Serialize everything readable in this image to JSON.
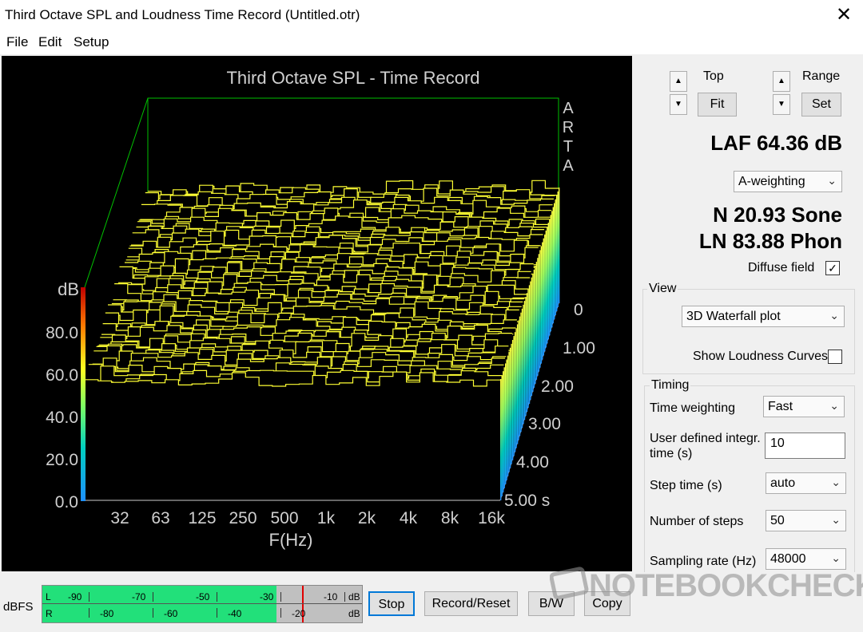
{
  "window": {
    "title": "Third Octave SPL and Loudness Time Record (Untitled.otr)",
    "close_glyph": "✕"
  },
  "menu": [
    "File",
    "Edit",
    "Setup"
  ],
  "plot": {
    "title": "Third Octave SPL - Time Record",
    "brand_letters": [
      "A",
      "R",
      "T",
      "A"
    ],
    "y_unit": "dB",
    "y_ticks": [
      "80.0",
      "60.0",
      "40.0",
      "20.0",
      "0.0"
    ],
    "x_ticks": [
      "32",
      "63",
      "125",
      "250",
      "500",
      "1k",
      "2k",
      "4k",
      "8k",
      "16k"
    ],
    "x_label": "F(Hz)",
    "t_ticks": [
      "0",
      "1.00",
      "2.00",
      "3.00",
      "4.00",
      "5.00 s"
    ],
    "trace_color": "#ffff33",
    "axis_color": "#00c000"
  },
  "chart_data": {
    "type": "area",
    "title": "Third Octave SPL - Time Record",
    "xlabel": "F(Hz)",
    "ylabel": "dB",
    "zlabel": "",
    "x_scale": "log",
    "x_ticks": [
      "32",
      "63",
      "125",
      "250",
      "500",
      "1k",
      "2k",
      "4k",
      "8k",
      "16k"
    ],
    "ylim": [
      0,
      100
    ],
    "time_range_s": [
      0,
      5
    ],
    "steps": 50,
    "approx_level_db": 60
  },
  "controls": {
    "top_label": "Top",
    "fit_label": "Fit",
    "range_label": "Range",
    "set_label": "Set",
    "spin_up": "▲",
    "spin_down": "▼",
    "laf": "LAF 64.36 dB",
    "weighting": "A-weighting",
    "loudness_n": "N 20.93 Sone",
    "loudness_ln": "LN 83.88 Phon",
    "diffuse_label": "Diffuse field",
    "diffuse_checked": "✓"
  },
  "view": {
    "group_label": "View",
    "mode": "3D Waterfall plot",
    "show_curves_label": "Show Loudness Curves"
  },
  "timing": {
    "group_label": "Timing",
    "time_weighting_label": "Time weighting",
    "time_weighting": "Fast",
    "user_integr_label_1": "User defined integr.",
    "user_integr_label_2": "time (s)",
    "user_integr_value": "10",
    "step_time_label": "Step time (s)",
    "step_time": "auto",
    "num_steps_label": "Number of steps",
    "num_steps": "50",
    "sampling_label": "Sampling rate (Hz)",
    "sampling": "48000"
  },
  "bottom": {
    "dbfs_label": "dBFS",
    "meter_L": "L",
    "meter_R": "R",
    "scale_top": [
      "-90",
      "-70",
      "-50",
      "-30",
      "-10"
    ],
    "scale_bottom": [
      "-80",
      "-60",
      "-40",
      "-20"
    ],
    "db_unit": "dB",
    "stop_label": "Stop",
    "record_label": "Record/Reset",
    "bw_label": "B/W",
    "copy_label": "Copy",
    "meter_level_fraction": 0.78
  },
  "watermark": "NOTEBOOKCHECK"
}
